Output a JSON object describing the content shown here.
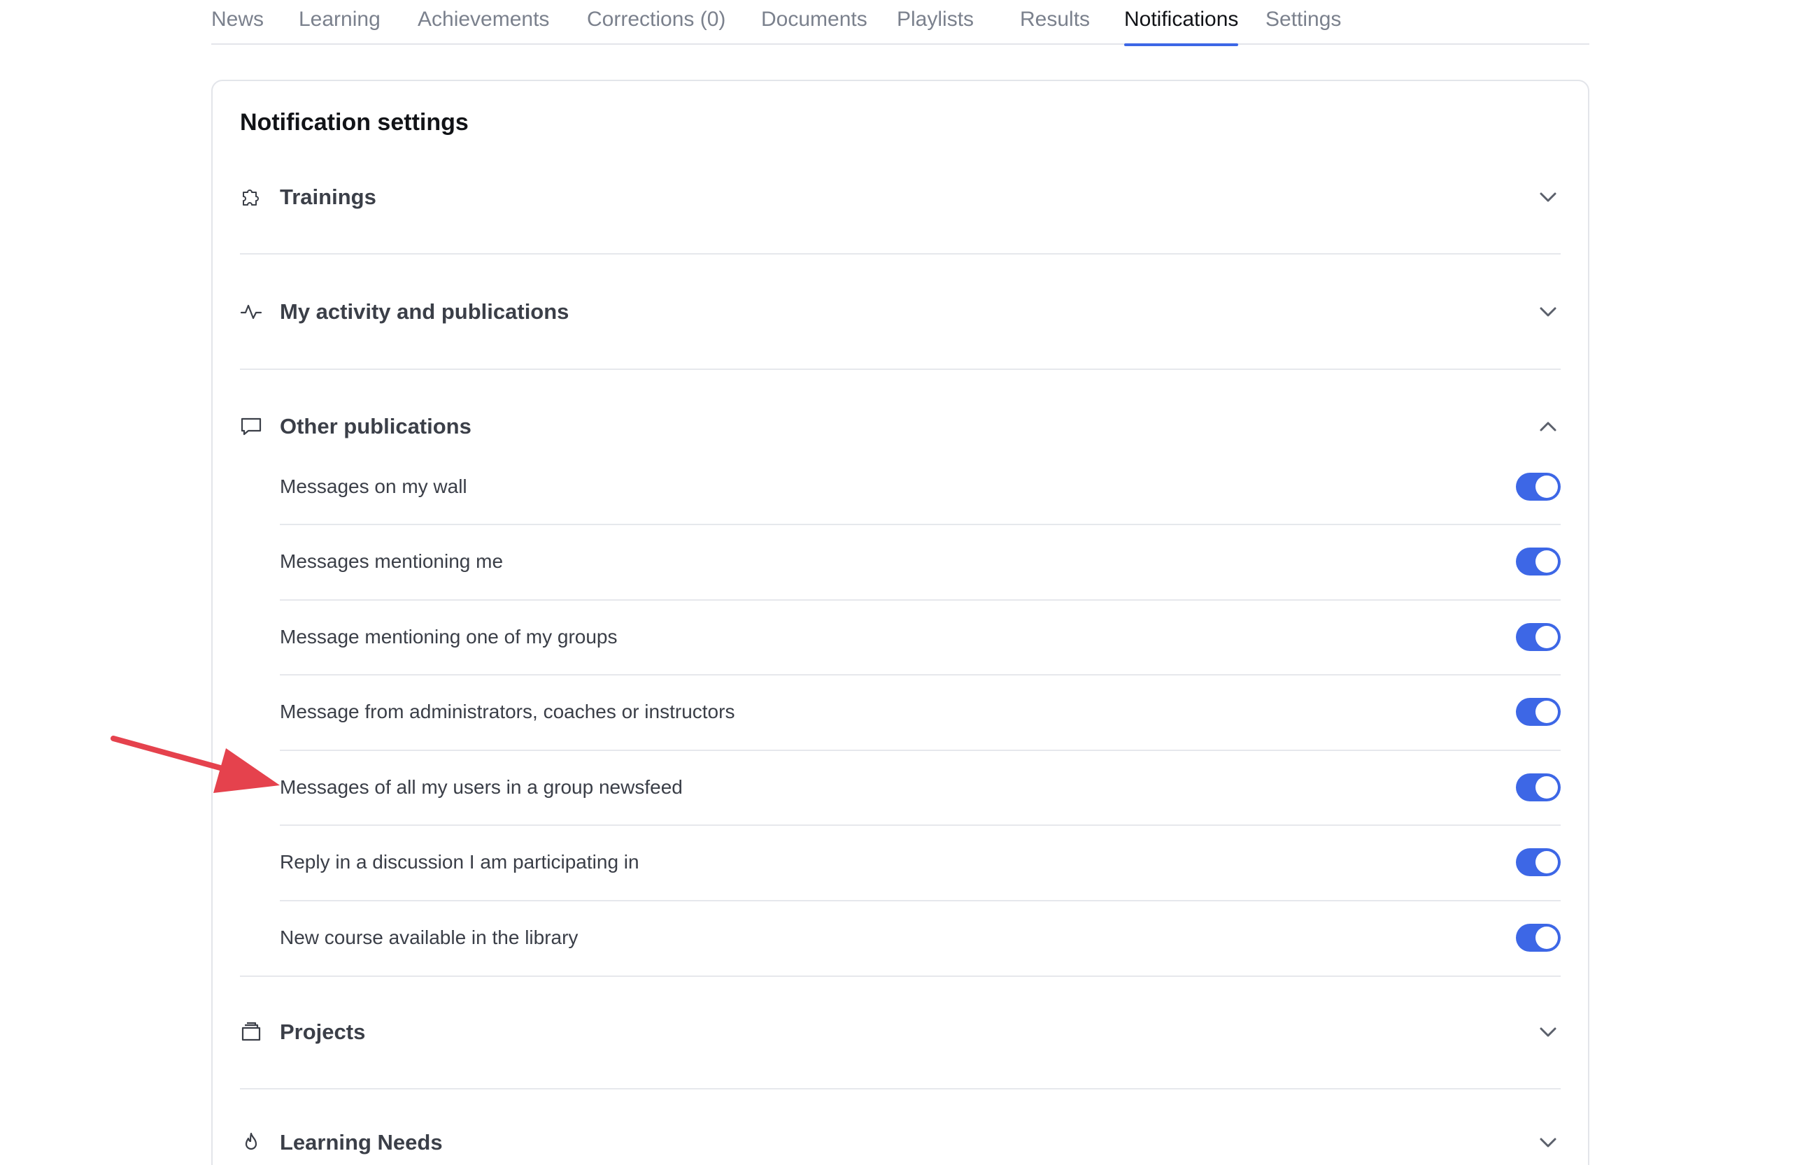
{
  "tabs": [
    {
      "label": "News"
    },
    {
      "label": "Learning"
    },
    {
      "label": "Achievements"
    },
    {
      "label": "Corrections (0)"
    },
    {
      "label": "Documents"
    },
    {
      "label": "Playlists"
    },
    {
      "label": "Results"
    },
    {
      "label": "Notifications",
      "active": true
    },
    {
      "label": "Settings"
    }
  ],
  "card": {
    "title": "Notification settings"
  },
  "sections": [
    {
      "label": "Trainings",
      "icon": "puzzle-icon",
      "expanded": false
    },
    {
      "label": "My activity and publications",
      "icon": "activity-icon",
      "expanded": false
    },
    {
      "label": "Other publications",
      "icon": "chat-bubble-icon",
      "expanded": true
    },
    {
      "label": "Projects",
      "icon": "folder-icon",
      "expanded": false
    },
    {
      "label": "Learning Needs",
      "icon": "flame-icon",
      "expanded": false
    }
  ],
  "other_publications": {
    "items": [
      {
        "label": "Messages on my wall",
        "enabled": true
      },
      {
        "label": "Messages mentioning me",
        "enabled": true
      },
      {
        "label": "Message mentioning one of my groups",
        "enabled": true
      },
      {
        "label": "Message from administrators, coaches or instructors",
        "enabled": true
      },
      {
        "label": "Messages of all my users in a group newsfeed",
        "enabled": true
      },
      {
        "label": "Reply in a discussion I am participating in",
        "enabled": true
      },
      {
        "label": "New course available in the library",
        "enabled": true
      }
    ]
  },
  "colors": {
    "accent": "#3d67e6",
    "annotation_arrow": "#e5424d"
  }
}
